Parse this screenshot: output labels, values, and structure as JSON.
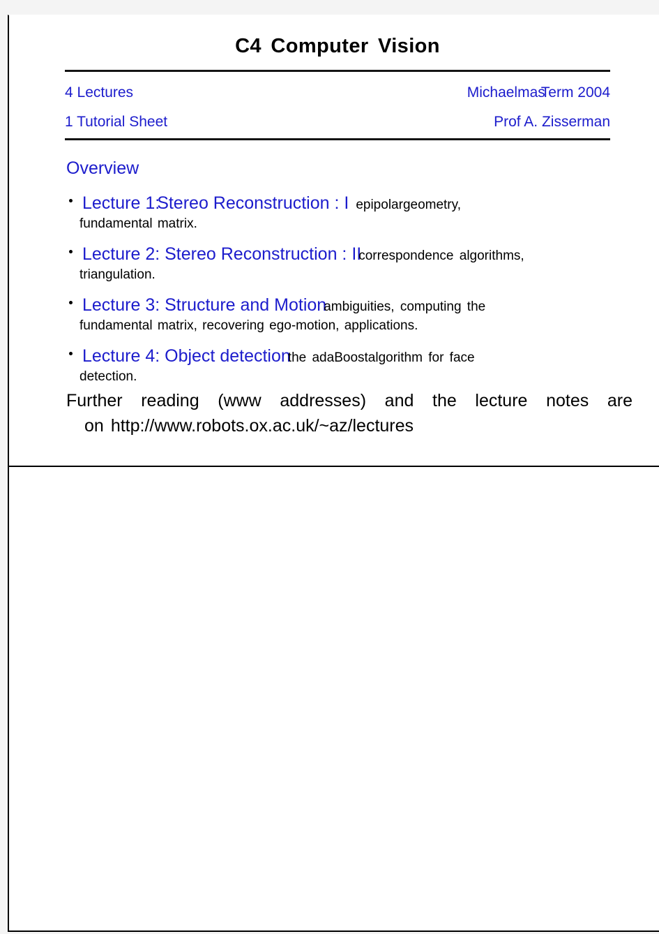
{
  "document": {
    "title": "C4  Computer  Vision",
    "header": {
      "left_line_1": "4 Lectures",
      "left_line_2": "1 Tutorial Sheet",
      "right_line_1_a": "Michaelmas",
      "right_line_1_b": "Term  2004",
      "right_line_2": "Prof A. Zisserman"
    },
    "section_heading": "Overview",
    "bullets": [
      {
        "heading": "Lecture  1:",
        "heading_2": "Stereo  Reconstruction : I",
        "tail_a": "epipolar",
        "tail_b": "geometry,",
        "body": "fundamental  matrix."
      },
      {
        "heading": "Lecture 2:  Stereo  Reconstruction : II",
        "heading_2": "",
        "tail_a": "correspondence  algorithms,",
        "tail_b": "",
        "body": "triangulation."
      },
      {
        "heading": "Lecture 3:  Structure  and  Motion",
        "heading_2": "",
        "tail_a": "ambiguities, computing  the",
        "tail_b": "",
        "body": "fundamental  matrix,  recovering  ego-motion,  applications."
      },
      {
        "heading": "Lecture 4:  Object  detection",
        "heading_2": "",
        "tail_a": "the  ada",
        "tail_b": "Boost",
        "tail_c": "algorithm  for  face",
        "body": "detection."
      }
    ],
    "further_reading": {
      "line_1": "Further reading (www addresses) and the lecture notes are",
      "line_2_prefix": "on",
      "line_2_url": "http://www.robots.ox.ac.uk/~az/lectures"
    },
    "colors": {
      "accent_blue": "#1c1ccc",
      "text_black": "#000000",
      "page_background": "#ffffff",
      "margin_gray": "#f4f4f4",
      "rule": "#141414"
    }
  }
}
